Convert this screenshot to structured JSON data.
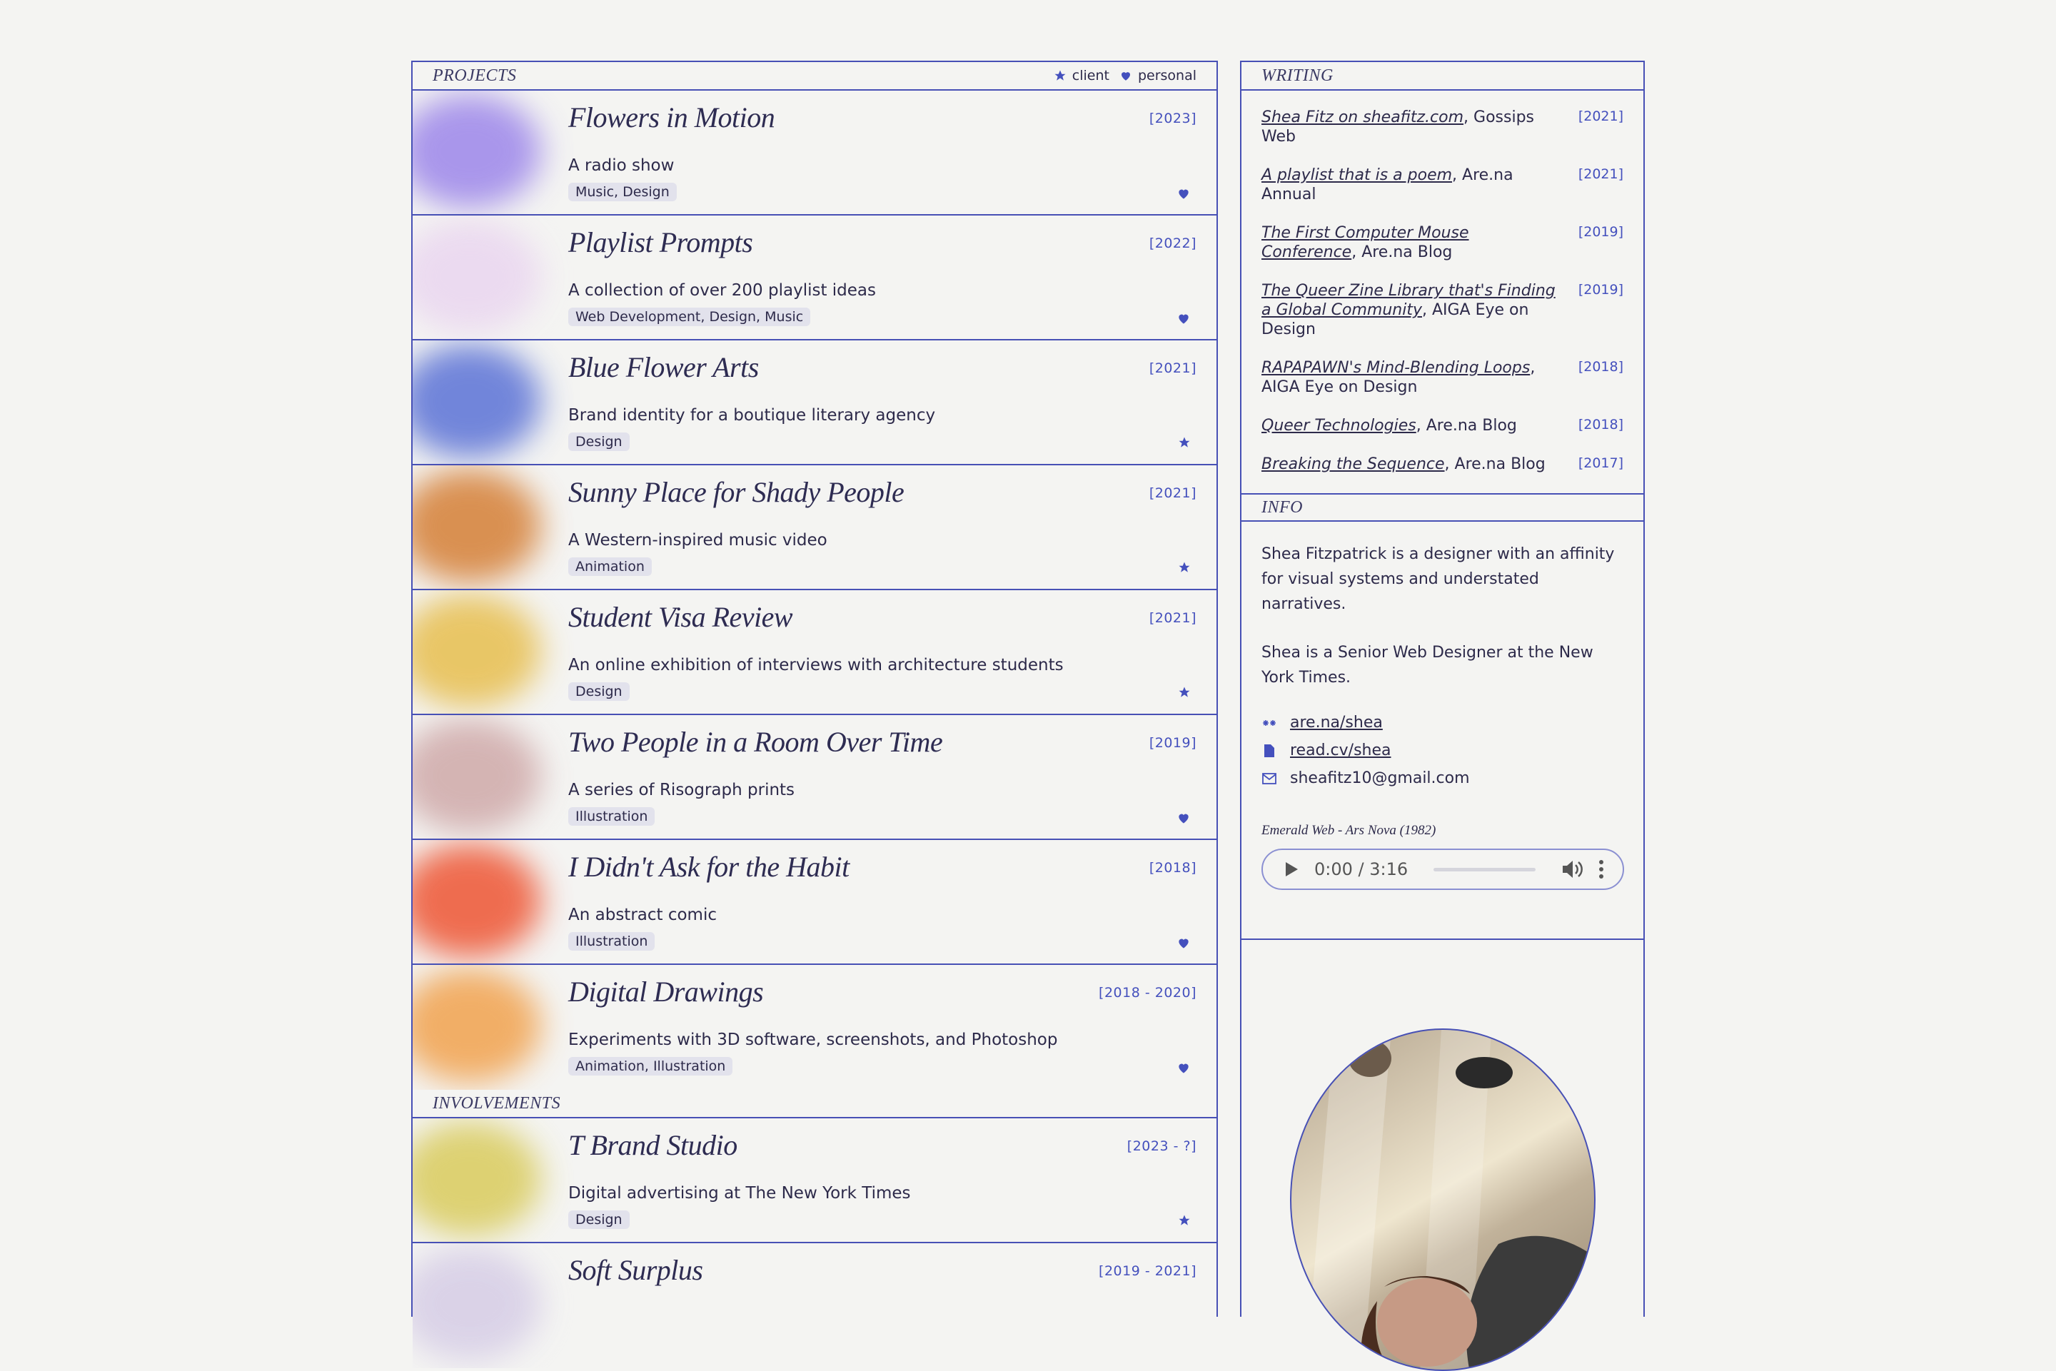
{
  "projects_header": {
    "label": "PROJECTS",
    "legend_client": "client",
    "legend_personal": "personal"
  },
  "projects": [
    {
      "title": "Flowers in Motion",
      "year": "[2023]",
      "desc": "A radio show",
      "tags": "Music, Design",
      "kind": "personal",
      "color": "#9c86ea"
    },
    {
      "title": "Playlist Prompts",
      "year": "[2022]",
      "desc": "A collection of over 200 playlist ideas",
      "tags": "Web Development, Design, Music",
      "kind": "personal",
      "color": "#ead6f0"
    },
    {
      "title": "Blue Flower Arts",
      "year": "[2021]",
      "desc": "Brand identity for a boutique literary agency",
      "tags": "Design",
      "kind": "client",
      "color": "#5b72d6"
    },
    {
      "title": "Sunny Place for Shady People",
      "year": "[2021]",
      "desc": "A Western-inspired music video",
      "tags": "Animation",
      "kind": "client",
      "color": "#d57f36"
    },
    {
      "title": "Student Visa Review",
      "year": "[2021]",
      "desc": "An online exhibition of interviews with architecture students",
      "tags": "Design",
      "kind": "client",
      "color": "#e7be4e"
    },
    {
      "title": "Two People in a Room Over Time",
      "year": "[2019]",
      "desc": "A series of Risograph prints",
      "tags": "Illustration",
      "kind": "personal",
      "color": "#cfa9a9"
    },
    {
      "title": "I Didn't Ask for the Habit",
      "year": "[2018]",
      "desc": "An abstract comic",
      "tags": "Illustration",
      "kind": "personal",
      "color": "#ee5533"
    },
    {
      "title": "Digital Drawings",
      "year": "[2018 - 2020]",
      "desc": "Experiments with 3D software, screenshots, and Photoshop",
      "tags": "Animation, Illustration",
      "kind": "personal",
      "color": "#f1a24e"
    }
  ],
  "involvements_header": {
    "label": "INVOLVEMENTS"
  },
  "involvements": [
    {
      "title": "T Brand Studio",
      "year": "[2023 - ?]",
      "desc": "Digital advertising at The New York Times",
      "tags": "Design",
      "kind": "client",
      "color": "#d9cb5c"
    },
    {
      "title": "Soft Surplus",
      "year": "[2019 - 2021]",
      "desc": "",
      "tags": "",
      "kind": "",
      "color": "#d6cde6"
    }
  ],
  "writing": {
    "label": "WRITING",
    "items": [
      {
        "link": "Shea Fitz on sheafitz.com",
        "rest": ", Gossips Web",
        "year": "[2021]"
      },
      {
        "link": "A playlist that is a poem",
        "rest": ", Are.na Annual",
        "year": "[2021]"
      },
      {
        "link": "The First Computer Mouse Conference",
        "rest": ", Are.na Blog",
        "year": "[2019]"
      },
      {
        "link": "The Queer Zine Library that's Finding a Global Community",
        "rest": ", AIGA Eye on Design",
        "year": "[2019]"
      },
      {
        "link": "RAPAPAWN's Mind-Blending Loops",
        "rest": ", AIGA Eye on Design",
        "year": "[2018]"
      },
      {
        "link": "Queer Technologies",
        "rest": ", Are.na Blog",
        "year": "[2018]"
      },
      {
        "link": "Breaking the Sequence",
        "rest": ", Are.na Blog",
        "year": "[2017]"
      }
    ]
  },
  "info": {
    "label": "INFO",
    "p1": "Shea Fitzpatrick is a designer with an affinity for visual systems and understated narratives.",
    "p2": "Shea is a Senior Web Designer at the New York Times.",
    "arena": "are.na/shea",
    "readcv": "read.cv/shea",
    "email": "sheafitz10@gmail.com",
    "song": "Emerald Web - Ars Nova (1982)",
    "player_time": "0:00 / 3:16"
  }
}
